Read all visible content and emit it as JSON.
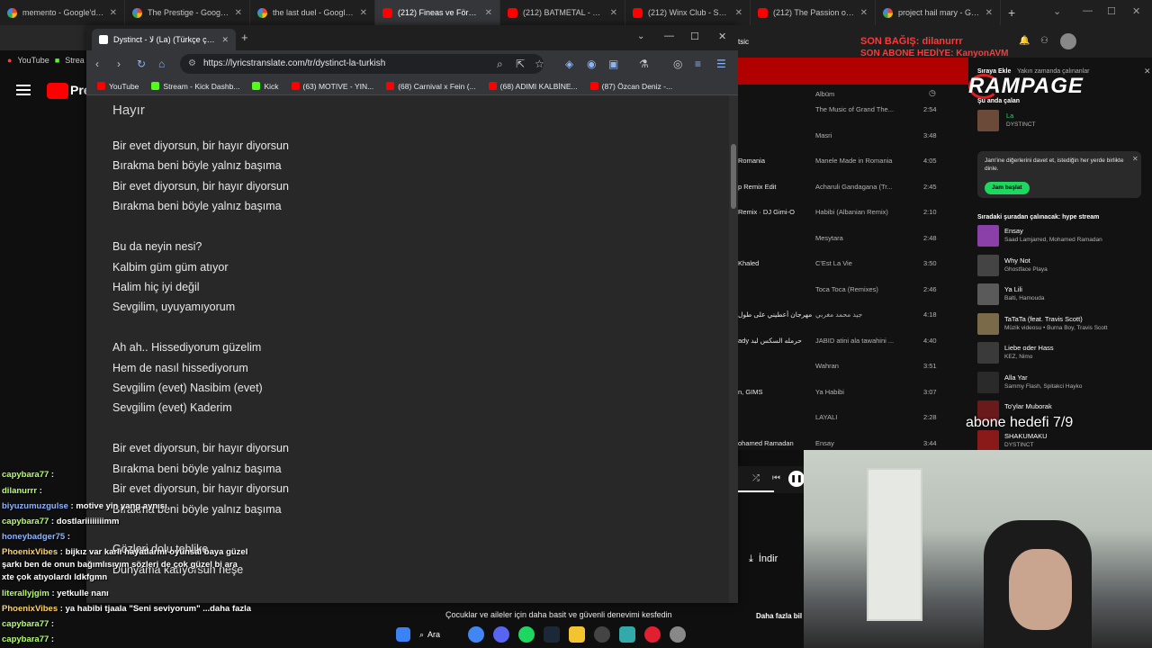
{
  "outer_tabs": [
    {
      "title": "memento - Google'da Ar",
      "icon": "google"
    },
    {
      "title": "The Prestige - Google'da",
      "icon": "google"
    },
    {
      "title": "the last duel - Google'da",
      "icon": "google"
    },
    {
      "title": "(212) Fineas ve Förb - Şar",
      "icon": "youtube"
    },
    {
      "title": "(212) BATMETAL - YouTub",
      "icon": "youtube"
    },
    {
      "title": "(212) Winx Club - Sen bir",
      "icon": "youtube"
    },
    {
      "title": "(212) The Passion of Joan",
      "icon": "youtube"
    },
    {
      "title": "project hail mary - Googl",
      "icon": "google"
    }
  ],
  "outer_bookmarks": [
    "YouTube",
    "Strea"
  ],
  "youtube_logo": "Pre",
  "inner_tab": {
    "title": "Dystinct - لا (La) (Türkçe çevirisi"
  },
  "inner_url": "https://lyricstranslate.com/tr/dystinct-la-turkish",
  "inner_bookmarks": [
    "YouTube",
    "Stream - Kick Dashb...",
    "Kick",
    "(63) MOTIVE - YIN...",
    "(68) Carnival x Fein (...",
    "(68) ADIMI KALBİNE...",
    "(87) Özcan Deniz -..."
  ],
  "page_heading": "Hayır",
  "lyrics": [
    "Bir evet diyorsun, bir hayır diyorsun",
    "Bırakma beni böyle yalnız başıma",
    "Bir evet diyorsun, bir hayır diyorsun",
    "Bırakma beni böyle yalnız başıma",
    "",
    "Bu da neyin nesi?",
    "Kalbim güm güm atıyor",
    "Halim hiç iyi değil",
    "Sevgilim, uyuyamıyorum",
    "",
    "Ah ah.. Hissediyorum güzelim",
    "Hem de nasıl hissediyorum",
    "Sevgilim (evet) Nasibim (evet)",
    "Sevgilim (evet) Kaderim",
    "",
    "Bir evet diyorsun, bir hayır diyorsun",
    "Bırakma beni böyle yalnız başıma",
    "Bir evet diyorsun, bir hayır diyorsun",
    "Bırakma beni böyle yalnız başıma",
    "",
    "Gözleri dolu tehlike",
    "Dünyama katıyorsun neşe"
  ],
  "spotify": {
    "top_label": "tsic",
    "album_header": "Albüm",
    "rows": [
      {
        "left": "",
        "album": "The Music of Grand The...",
        "dur": "2:54"
      },
      {
        "left": "",
        "album": "Masri",
        "dur": "3:48"
      },
      {
        "left": "Romania",
        "album": "Manele Made in Romania",
        "dur": "4:05"
      },
      {
        "left": "p Remix Edit",
        "album": "Acharuli Gandagana (Tr...",
        "dur": "2:45"
      },
      {
        "left": "Remix · DJ Gimi-O",
        "album": "Habibi (Albanian Remix)",
        "dur": "2:10"
      },
      {
        "left": "",
        "album": "Mesytara",
        "dur": "2:48"
      },
      {
        "left": "Khaled",
        "album": "C'Est La Vie",
        "dur": "3:50"
      },
      {
        "left": "",
        "album": "Toca Toca (Remixes)",
        "dur": "2:46"
      },
      {
        "left": "مهرجان أعطيني على طول",
        "album": "جيد محمد مغربي",
        "dur": "4:18"
      },
      {
        "left": "ady حرمله السكس لبد",
        "album": "JABID atini ala tawahini ...",
        "dur": "4:40"
      },
      {
        "left": "",
        "album": "Wahran",
        "dur": "3:51"
      },
      {
        "left": "n, GIMS",
        "album": "Ya Habibi",
        "dur": "3:07"
      },
      {
        "left": "",
        "album": "LAYALI",
        "dur": "2:28"
      },
      {
        "left": "ohamed Ramadan",
        "album": "Ensay",
        "dur": "3:44"
      }
    ],
    "queue_tabs": [
      "Sıraya Ekle",
      "Yakın zamanda çalınanlar"
    ],
    "now_playing_label": "Şu anda çalan",
    "now_playing": {
      "title": "La",
      "artist": "DYSTINCT"
    },
    "jam_text": "Jam'ine diğerlerini davet et, istediğin her yerde birlikte dinle.",
    "jam_button": "Jam başlat",
    "next_label": "Sıradaki şuradan çalınacak: hype stream",
    "queue": [
      {
        "title": "Ensay",
        "artist": "Saad Lamjarred, Mohamed Ramadan",
        "color": "#8b3fa8"
      },
      {
        "title": "Why Not",
        "artist": "Ghostface Playa",
        "color": "#444444"
      },
      {
        "title": "Ya Lili",
        "artist": "Balti, Hamouda",
        "color": "#5a5a5a"
      },
      {
        "title": "TaTaTa (feat. Travis Scott)",
        "artist": "Müzik videosu • Burna Boy, Travis Scott",
        "color": "#7a6a4a"
      },
      {
        "title": "Liebe oder Hass",
        "artist": "KEZ, Nimo",
        "color": "#3a3a3a"
      },
      {
        "title": "Alla Yar",
        "artist": "Sammy Flash, Spitakci Hayko",
        "color": "#2a2a2a"
      },
      {
        "title": "To'ylar Muborak",
        "artist": "",
        "color": "#6a1a1a"
      },
      {
        "title": "SHAKUMAKU",
        "artist": "DYSTINCT",
        "color": "#8a1a1a"
      }
    ],
    "download_label": "İndir",
    "more_label": "Daha fazla bil"
  },
  "overlay": {
    "alert_line1": "SON BAĞIŞ: dilanurrr",
    "alert_line2": "SON ABONE HEDİYE: KanyonAVM",
    "brand": "RAMPAGE",
    "sub_goal": "abone hedefi 7/9"
  },
  "chat": [
    {
      "user": "capybara77",
      "msg": ""
    },
    {
      "user": "dilanurrr",
      "msg": ""
    },
    {
      "user": "biyuzumuzgulse",
      "msg": "motive yin yang aynısı"
    },
    {
      "user": "capybara77",
      "msg": "dostlariiiiiiiimm"
    },
    {
      "user": "honeybadger75",
      "msg": ""
    },
    {
      "user": "PhoenixVibes",
      "msg": "bijkız var karlı hayatlarmı oyunsal baya güzel"
    },
    {
      "user": "",
      "msg": "şarkı ben de onun bağımlısıyım sözleri de çok güzel bi ara"
    },
    {
      "user": "",
      "msg": "xte çok atıyolardı ldkfgmn"
    },
    {
      "user": "literallyjgim",
      "msg": "yetkulle nanı"
    },
    {
      "user": "PhoenixVibes",
      "msg": "ya habibi tjaala \"Seni seviyorum\" ...daha fazla"
    },
    {
      "user": "capybara77",
      "msg": ""
    },
    {
      "user": "capybara77",
      "msg": ""
    }
  ],
  "family_text": "Çocuklar ve aileler için daha basit ve güvenli denevimi kesfedin",
  "taskbar_search": "Ara"
}
